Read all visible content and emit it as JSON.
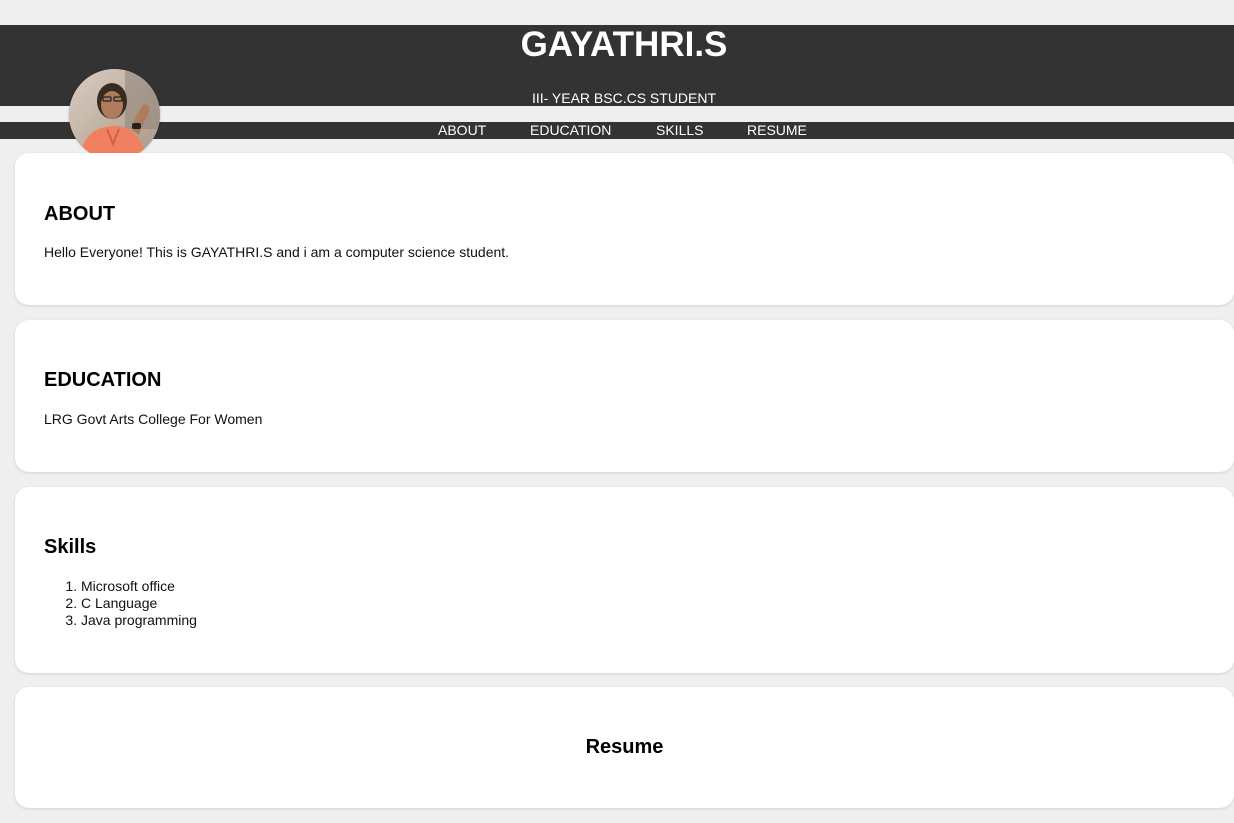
{
  "header": {
    "title": "GAYATHRI.S",
    "subtitle": "III- YEAR BSC.CS STUDENT",
    "background": "#333333",
    "avatar_alt": "profile photo"
  },
  "nav": {
    "items": [
      {
        "label": "ABOUT"
      },
      {
        "label": "EDUCATION"
      },
      {
        "label": "SKILLS"
      },
      {
        "label": "RESUME"
      }
    ]
  },
  "about": {
    "heading": "ABOUT",
    "text": "Hello Everyone! This is GAYATHRI.S and i am a computer science student."
  },
  "education": {
    "heading": "EDUCATION",
    "text": "LRG Govt Arts College For Women"
  },
  "skills": {
    "heading": "Skills",
    "items": [
      "Microsoft office",
      "C Language",
      "Java programming"
    ]
  },
  "resume": {
    "heading": "Resume"
  },
  "colors": {
    "page_background": "#efefef",
    "card_background": "#ffffff",
    "header_background": "#333333",
    "header_text": "#ffffff"
  }
}
